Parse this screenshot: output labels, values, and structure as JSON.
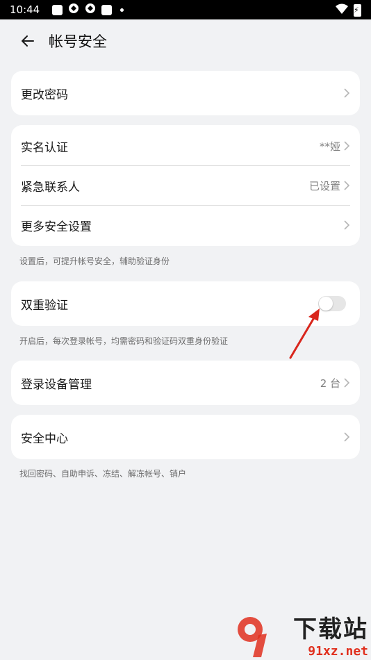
{
  "status_bar": {
    "time": "10:44"
  },
  "header": {
    "title": "帐号安全"
  },
  "groups": {
    "password": {
      "label": "更改密码"
    },
    "identity": {
      "rows": [
        {
          "label": "实名认证",
          "value": "**娅"
        },
        {
          "label": "紧急联系人",
          "value": "已设置"
        },
        {
          "label": "更多安全设置",
          "value": ""
        }
      ],
      "note": "设置后，可提升帐号安全，辅助验证身份"
    },
    "two_factor": {
      "label": "双重验证",
      "enabled": false,
      "note": "开启后，每次登录帐号，均需密码和验证码双重身份验证"
    },
    "devices": {
      "label": "登录设备管理",
      "value": "2 台"
    },
    "security_center": {
      "label": "安全中心",
      "note": "找回密码、自助申诉、冻结、解冻帐号、销户"
    }
  },
  "watermark": {
    "brand": "下载站",
    "site": "91xz.net"
  },
  "colors": {
    "background": "#f1f2f4",
    "card": "#ffffff",
    "annotation_arrow": "#d9261c"
  }
}
